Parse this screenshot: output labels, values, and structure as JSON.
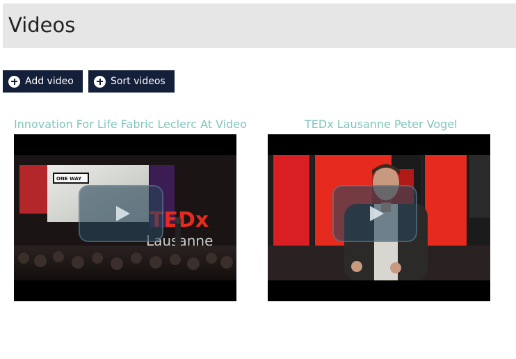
{
  "page": {
    "title": "Videos"
  },
  "toolbar": {
    "add_label": "Add video",
    "sort_label": "Sort videos"
  },
  "videos": [
    {
      "title": "Innovation For Life Fabric Leclerc At Video",
      "thumbnail_text": {
        "sign": "ONE WAY",
        "logo": "TEDx",
        "logo_sub": "Lausanne"
      }
    },
    {
      "title": "TEDx Lausanne Peter Vogel"
    }
  ],
  "colors": {
    "header_bg": "#e6e6e6",
    "button_bg": "#14203a",
    "link": "#7fc5bd",
    "ted_red": "#e62b1e"
  }
}
